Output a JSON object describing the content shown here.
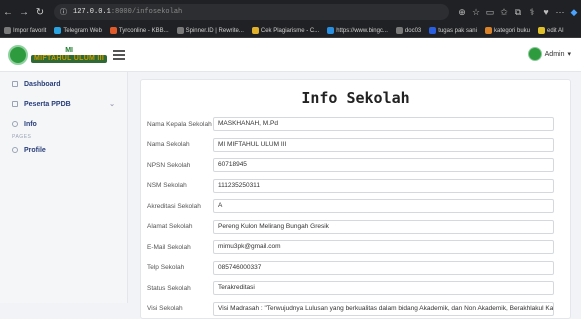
{
  "browser": {
    "url_host": "127.0.0.1",
    "url_path": ":8000/infosekolah",
    "bookmarks": [
      "Impor favorit",
      "Telegram Web",
      "Tyrconline - KBB...",
      "Spinner.ID | Rewrite...",
      "Cek Plagiarisme - C...",
      "https://www.bingc...",
      "doc03",
      "tugas pak sani",
      "kategori buku",
      "edit AI"
    ]
  },
  "header": {
    "logo_top": "MI",
    "logo_bottom": "MIFTAHUL ULUM III",
    "user": "Admin"
  },
  "sidebar": {
    "items": [
      {
        "label": "Dashboard"
      },
      {
        "label": "Peserta PPDB",
        "caret": "⌄"
      },
      {
        "label": "Info"
      }
    ],
    "section": "PAGES",
    "profile": "Profile"
  },
  "main": {
    "title": "Info Sekolah",
    "fields": [
      {
        "label": "Nama Kepala Sekolah",
        "value": "MASKHANAH, M.Pd"
      },
      {
        "label": "Nama Sekolah",
        "value": "MI MIFTAHUL ULUM III"
      },
      {
        "label": "NPSN Sekolah",
        "value": "60718945"
      },
      {
        "label": "NSM Sekolah",
        "value": "111235250311"
      },
      {
        "label": "Akreditasi Sekolah",
        "value": "A"
      },
      {
        "label": "Alamat Sekolah",
        "value": "Pereng Kulon Melirang Bungah Gresik"
      },
      {
        "label": "E-Mail Sekolah",
        "value": "mimu3pk@gmail.com"
      },
      {
        "label": "Telp Sekolah",
        "value": "085746000337"
      },
      {
        "label": "Status Sekolah",
        "value": "Terakreditasi"
      },
      {
        "label": "Visi Sekolah",
        "value": "Visi Madrasah : \"Terwujudnya Lulusan yang berkualitas dalam bidang Akademik, dan Non Akademik, Berakhlakul Karimah"
      }
    ]
  }
}
